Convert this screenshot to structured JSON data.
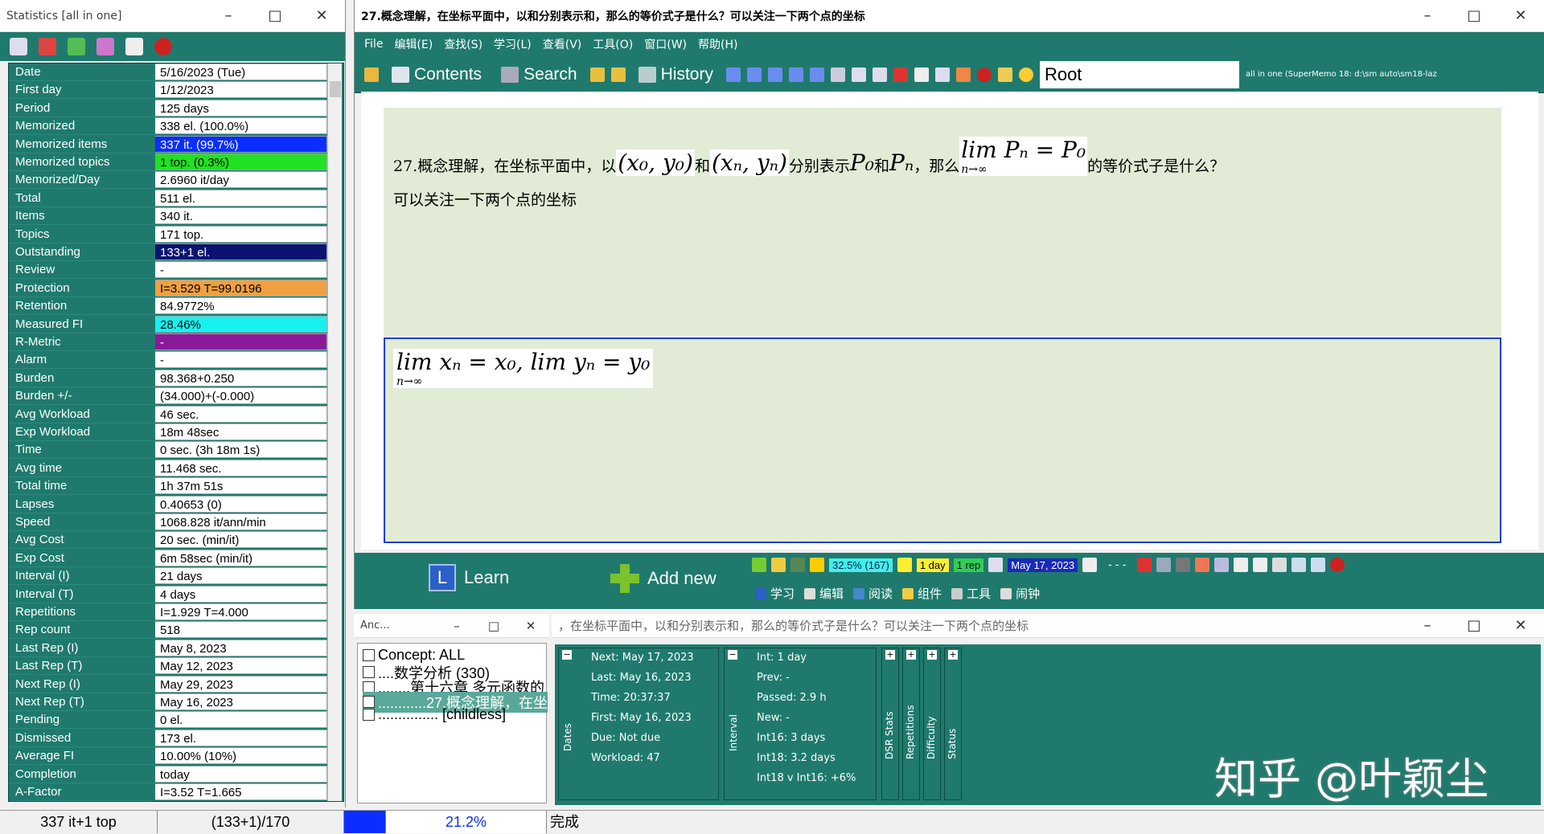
{
  "stats": {
    "title": "Statistics [all in one]",
    "rows": [
      {
        "k": "Date",
        "v": "5/16/2023 (Tue)"
      },
      {
        "k": "First day",
        "v": "1/12/2023"
      },
      {
        "k": "Period",
        "v": "125 days"
      },
      {
        "k": "Memorized",
        "v": "338 el. (100.0%)"
      },
      {
        "k": "Memorized items",
        "v": "337 it. (99.7%)",
        "bg": "#0a2eff",
        "fg": "#ffffff"
      },
      {
        "k": "Memorized topics",
        "v": "1 top. (0.3%)",
        "bg": "#22e022",
        "fg": "#000000"
      },
      {
        "k": "Memorized/Day",
        "v": "2.6960 it/day"
      },
      {
        "k": "Total",
        "v": "511 el."
      },
      {
        "k": "Items",
        "v": "340 it."
      },
      {
        "k": "Topics",
        "v": "171 top."
      },
      {
        "k": "Outstanding",
        "v": "133+1 el.",
        "bg": "#0a1470",
        "fg": "#ffffff"
      },
      {
        "k": "Review",
        "v": "-"
      },
      {
        "k": "Protection",
        "v": "I=3.529 T=99.0196",
        "bg": "#f0a040",
        "fg": "#000000"
      },
      {
        "k": "Retention",
        "v": "84.9772%"
      },
      {
        "k": "Measured FI",
        "v": "28.46%",
        "bg": "#18f0f0",
        "fg": "#000000"
      },
      {
        "k": "R-Metric",
        "v": "-",
        "bg": "#8a1a9a",
        "fg": "#ffffff"
      },
      {
        "k": "Alarm",
        "v": "-"
      },
      {
        "k": "Burden",
        "v": "98.368+0.250"
      },
      {
        "k": "Burden +/-",
        "v": "(34.000)+(-0.000)"
      },
      {
        "k": "Avg Workload",
        "v": "46 sec."
      },
      {
        "k": "Exp Workload",
        "v": "18m 48sec"
      },
      {
        "k": "Time",
        "v": "0 sec. (3h 18m 1s)"
      },
      {
        "k": "Avg time",
        "v": "11.468 sec."
      },
      {
        "k": "Total time",
        "v": "1h 37m 51s"
      },
      {
        "k": "Lapses",
        "v": "0.40653 (0)"
      },
      {
        "k": "Speed",
        "v": "1068.828 it/ann/min"
      },
      {
        "k": "Avg Cost",
        "v": "20 sec. (min/it)"
      },
      {
        "k": "Exp Cost",
        "v": "6m 58sec (min/it)"
      },
      {
        "k": "Interval (I)",
        "v": "21 days"
      },
      {
        "k": "Interval (T)",
        "v": "4 days"
      },
      {
        "k": "Repetitions",
        "v": "I=1.929 T=4.000"
      },
      {
        "k": "Rep count",
        "v": "518"
      },
      {
        "k": "Last Rep (I)",
        "v": "May 8, 2023"
      },
      {
        "k": "Last Rep (T)",
        "v": "May 12, 2023"
      },
      {
        "k": "Next Rep (I)",
        "v": "May 29, 2023"
      },
      {
        "k": "Next Rep (T)",
        "v": "May 16, 2023"
      },
      {
        "k": "Pending",
        "v": "0 el."
      },
      {
        "k": "Dismissed",
        "v": "173 el."
      },
      {
        "k": "Average FI",
        "v": "10.00% (10%)"
      },
      {
        "k": "Completion",
        "v": "today"
      },
      {
        "k": "A-Factor",
        "v": "I=3.52 T=1.665"
      }
    ]
  },
  "main": {
    "title": "27.概念理解，在坐标平面中，以和分别表示和，那么的等价式子是什么？可以关注一下两个点的坐标",
    "menu": [
      "File",
      "编辑(E)",
      "查找(S)",
      "学习(L)",
      "查看(V)",
      "工具(O)",
      "窗口(W)",
      "帮助(H)"
    ],
    "nav": {
      "contents": "Contents",
      "search": "Search",
      "history": "History",
      "root": "Root",
      "path": "all in one (SuperMemo 18: d:\\sm auto\\sm18-laz"
    },
    "question": {
      "p1": "27.概念理解，在坐标平面中，以",
      "m1": "(x₀, y₀)",
      "p2": "和",
      "m2": "(xₙ, yₙ)",
      "p3": "分别表示",
      "m3": "P₀",
      "p4": "和",
      "m4": "Pₙ",
      "p5": "，那么",
      "m5": "lim Pₙ = P₀",
      "m5sub": "n→∞",
      "p6": "的等价式子是什么？",
      "line2": "可以关注一下两个点的坐标"
    },
    "answer": {
      "m": "lim xₙ = x₀, lim yₙ = y₀",
      "sub": "n→∞"
    },
    "learn": "Learn",
    "addnew": "Add new",
    "bar": {
      "pct": "32.5% (167)",
      "day": "1 day",
      "rep": "1 rep",
      "date": "May 17, 2023"
    },
    "tabs": [
      "学习",
      "编辑",
      "阅读",
      "组件",
      "工具",
      "闹钟"
    ]
  },
  "anc": {
    "title": "Anc...",
    "items": [
      "Concept: ALL",
      "....数学分析 (330)",
      "........第十六章 多元函数的",
      "............27.概念理解，在坐",
      "............... [childless]"
    ]
  },
  "elem": {
    "title": "，在坐标平面中，以和分别表示和，那么的等价式子是什么？可以关注一下两个点的坐标",
    "dates": {
      "label": "Dates",
      "next": "Next: May 17, 2023",
      "last": "Last: May 16, 2023",
      "time": "Time: 20:37:37",
      "first": "First: May 16, 2023",
      "due": "Due: Not due",
      "workload": "Workload: 47"
    },
    "interval": {
      "label": "Interval",
      "int": "Int: 1 day",
      "prev": "Prev: -",
      "passed": "Passed: 2.9 h",
      "new": "New: -",
      "int16": "Int16: 3 days",
      "int18": "Int18: 3.2 days",
      "cmp": "Int18 v Int16: +6%"
    },
    "side": [
      "DSR Stats",
      "Repetitions",
      "Difficulty",
      "Status"
    ]
  },
  "watermark": "知乎 @叶颖尘",
  "statusbar": {
    "a": "337 it+1 top",
    "b": "(133+1)/170",
    "pct": "21.2%",
    "msg": "完成"
  }
}
